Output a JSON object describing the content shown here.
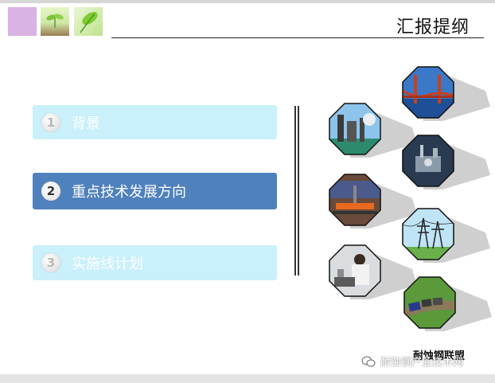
{
  "header": {
    "title": "汇报提纲"
  },
  "menu": [
    {
      "number": "1",
      "label": "背景",
      "active": false
    },
    {
      "number": "2",
      "label": "重点技术发展方向",
      "active": true
    },
    {
      "number": "3",
      "label": "实施线计划",
      "active": false
    }
  ],
  "images": [
    {
      "name": "golden-gate-bridge"
    },
    {
      "name": "steel-plant"
    },
    {
      "name": "offshore-platform"
    },
    {
      "name": "steel-rolling"
    },
    {
      "name": "power-towers"
    },
    {
      "name": "lab-worker"
    },
    {
      "name": "freight-train"
    }
  ],
  "brand": "耐蚀钢联盟",
  "footer": {
    "text": "耐蚀钢产业技术网",
    "icon": "chat-icon"
  },
  "colors": {
    "active_bg": "#4f81bd",
    "inactive_bg": "#c9f0fb",
    "title_line": "#222222"
  }
}
